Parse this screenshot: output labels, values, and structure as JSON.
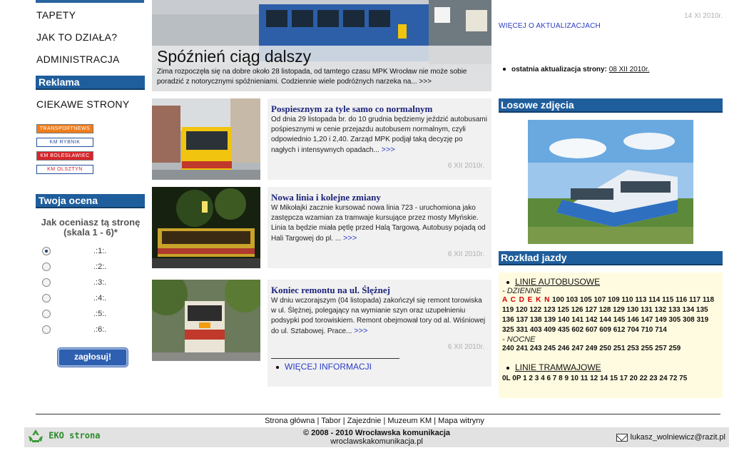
{
  "left": {
    "menu": [
      "TAPETY",
      "JAK TO DZIAŁA?",
      "ADMINISTRACJA"
    ],
    "ads_heading": "Reklama",
    "interesting": "CIEKAWE STRONY",
    "banners": [
      "TRANSPORTNEWS",
      "KM RYBNIK",
      "KM BOLESŁAWIEC",
      "KM OLSZTYN"
    ],
    "rating_heading": "Twoja ocena",
    "rating_question": "Jak oceniasz tą stronę (skala 1 - 6)*",
    "rating_options": [
      ".:1:.",
      ".:2:.",
      ".:3:.",
      ".:4:.",
      ".:5:.",
      ".:6:."
    ],
    "vote_label": "zagłosuj!"
  },
  "hero": {
    "title": "Spóźnień ciąg dalszy",
    "text": "Zima rozpoczęła się na dobre około 28 listopada, od tamtego czasu MPK Wrocław nie może sobie poradzić z notorycznymi spóźnieniami. Codziennie wiele podróżnych narzeka na... >>>"
  },
  "news": [
    {
      "title": "Pospiesznym za tyle samo co normalnym",
      "text": "Od dnia 29 listopada br. do 10 grudnia będziemy jeździć autobusami pośpiesznymi w cenie przejazdu autobusem normalnym, czyli odpowiednio 1,20 i 2,40. Zarząd MPK podjął taką decyzję po nagłych i intensywnych opadach...",
      "more": ">>>",
      "date": "6 XII 2010r."
    },
    {
      "title": "Nowa linia i kolejne zmiany",
      "text": "W Mikołajki zacznie kursować nowa linia 723 - uruchomiona jako zastępcza wzamian za tramwaje kursujące przez mosty Młyńskie. Linia ta będzie miała pętlę przed Halą Targową. Autobusy pojadą od Hali Targowej do pl. ...",
      "more": ">>>",
      "date": "6 XII 2010r."
    },
    {
      "title": "Koniec remontu na ul. Ślężnej",
      "text": "W dniu wczorajszym (04 listopada) zakończył się remont torowiska w ul. Ślężnej, polegający na wymianie szyn oraz uzupełnieniu podsypki pod torowiskiem. Remont obejmował tory od al. Wiśniowej do ul. Sztabowej. Prace...",
      "more": ">>>",
      "date": "6 XII 2010r."
    }
  ],
  "more_info": "WIĘCEJ INFORMACJI",
  "right": {
    "update_date": "14 XI 2010r.",
    "update_more": "WIĘCEJ O AKTUALIZACJACH",
    "last_update_label": "ostatnia aktualizacja strony:",
    "last_update_date": "08 XII 2010r.",
    "random_photos": "Losowe zdjęcia",
    "timetable_heading": "Rozkład jazdy",
    "bus_lines": "LINIE AUTOBUSOWE",
    "day_label": "- DZIENNE",
    "day_letters": "A C D E K N",
    "day_numbers": "100 103 105 107 109 110 113 114 115 116 117 118 119 120 122 123 125 126 127 128 129 130 131 132 133 134 135 136 137 138 139 140 141 142 144 145 146 147 149 305 308 319 325 331 403 409 435 602 607 609 612 704 710 714",
    "night_label": "- NOCNE",
    "night_numbers": "240 241 243 245 246 247 249 250 251 253 255 257 259",
    "tram_lines": "LINIE TRAMWAJOWE",
    "tram_numbers": "0L 0P 1 2 3 4 6 7 8 9 10 11 12 14 15 17 20 22 23 24 72 75"
  },
  "footer": {
    "links": [
      "Strona główna",
      "Tabor",
      "Zajezdnie",
      "Muzeum KM",
      "Mapa witryny"
    ],
    "eko": "EKO strona",
    "copyright": "© 2008 - 2010 Wrocławska komunikacja",
    "site": "wroclawskakomunikacja.pl",
    "email": "lukasz_wolniewicz@razit.pl"
  },
  "colors": {
    "header_blue": "#1f5e9c",
    "link_blue": "#2a3bc4",
    "title_navy": "#1c237a",
    "timetable_bg": "#fffbe0"
  }
}
